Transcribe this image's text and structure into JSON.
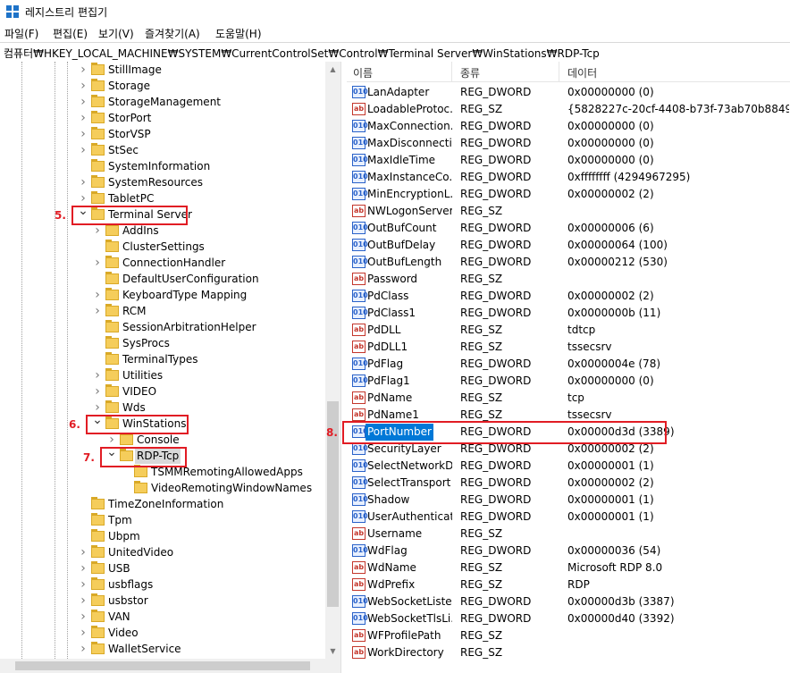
{
  "window": {
    "title": "레지스트리 편집기",
    "icon": "regedit-icon"
  },
  "menu": [
    "파일(F)",
    "편집(E)",
    "보기(V)",
    "즐겨찾기(A)",
    "도움말(H)"
  ],
  "address": "컴퓨터₩HKEY_LOCAL_MACHINE₩SYSTEM₩CurrentControlSet₩Control₩Terminal Server₩WinStations₩RDP-Tcp",
  "tree": {
    "nodes": [
      {
        "label": "StillImage",
        "level": 0,
        "expander": "collapsed"
      },
      {
        "label": "Storage",
        "level": 0,
        "expander": "collapsed"
      },
      {
        "label": "StorageManagement",
        "level": 0,
        "expander": "collapsed"
      },
      {
        "label": "StorPort",
        "level": 0,
        "expander": "collapsed"
      },
      {
        "label": "StorVSP",
        "level": 0,
        "expander": "collapsed"
      },
      {
        "label": "StSec",
        "level": 0,
        "expander": "collapsed"
      },
      {
        "label": "SystemInformation",
        "level": 0,
        "expander": "none"
      },
      {
        "label": "SystemResources",
        "level": 0,
        "expander": "collapsed"
      },
      {
        "label": "TabletPC",
        "level": 0,
        "expander": "collapsed"
      },
      {
        "label": "Terminal Server",
        "level": 0,
        "expander": "expanded"
      },
      {
        "label": "AddIns",
        "level": 1,
        "expander": "collapsed"
      },
      {
        "label": "ClusterSettings",
        "level": 1,
        "expander": "none"
      },
      {
        "label": "ConnectionHandler",
        "level": 1,
        "expander": "collapsed"
      },
      {
        "label": "DefaultUserConfiguration",
        "level": 1,
        "expander": "none"
      },
      {
        "label": "KeyboardType Mapping",
        "level": 1,
        "expander": "collapsed"
      },
      {
        "label": "RCM",
        "level": 1,
        "expander": "collapsed"
      },
      {
        "label": "SessionArbitrationHelper",
        "level": 1,
        "expander": "none"
      },
      {
        "label": "SysProcs",
        "level": 1,
        "expander": "none"
      },
      {
        "label": "TerminalTypes",
        "level": 1,
        "expander": "none"
      },
      {
        "label": "Utilities",
        "level": 1,
        "expander": "collapsed"
      },
      {
        "label": "VIDEO",
        "level": 1,
        "expander": "collapsed"
      },
      {
        "label": "Wds",
        "level": 1,
        "expander": "collapsed"
      },
      {
        "label": "WinStations",
        "level": 1,
        "expander": "expanded"
      },
      {
        "label": "Console",
        "level": 2,
        "expander": "collapsed"
      },
      {
        "label": "RDP-Tcp",
        "level": 2,
        "expander": "expanded",
        "selected": true
      },
      {
        "label": "TSMMRemotingAllowedApps",
        "level": 3,
        "expander": "none"
      },
      {
        "label": "VideoRemotingWindowNames",
        "level": 3,
        "expander": "none"
      },
      {
        "label": "TimeZoneInformation",
        "level": 0,
        "expander": "none"
      },
      {
        "label": "Tpm",
        "level": 0,
        "expander": "none"
      },
      {
        "label": "Ubpm",
        "level": 0,
        "expander": "none"
      },
      {
        "label": "UnitedVideo",
        "level": 0,
        "expander": "collapsed"
      },
      {
        "label": "USB",
        "level": 0,
        "expander": "collapsed"
      },
      {
        "label": "usbflags",
        "level": 0,
        "expander": "collapsed"
      },
      {
        "label": "usbstor",
        "level": 0,
        "expander": "collapsed"
      },
      {
        "label": "VAN",
        "level": 0,
        "expander": "collapsed"
      },
      {
        "label": "Video",
        "level": 0,
        "expander": "collapsed"
      },
      {
        "label": "WalletService",
        "level": 0,
        "expander": "collapsed"
      }
    ]
  },
  "columns": [
    "이름",
    "종류",
    "데이터"
  ],
  "values": [
    {
      "name": "LanAdapter",
      "type": "REG_DWORD",
      "data": "0x00000000 (0)"
    },
    {
      "name": "LoadableProtoc...",
      "type": "REG_SZ",
      "data": "{5828227c-20cf-4408-b73f-73ab70b8849f}"
    },
    {
      "name": "MaxConnection...",
      "type": "REG_DWORD",
      "data": "0x00000000 (0)"
    },
    {
      "name": "MaxDisconnecti...",
      "type": "REG_DWORD",
      "data": "0x00000000 (0)"
    },
    {
      "name": "MaxIdleTime",
      "type": "REG_DWORD",
      "data": "0x00000000 (0)"
    },
    {
      "name": "MaxInstanceCo...",
      "type": "REG_DWORD",
      "data": "0xffffffff (4294967295)"
    },
    {
      "name": "MinEncryptionL...",
      "type": "REG_DWORD",
      "data": "0x00000002 (2)"
    },
    {
      "name": "NWLogonServer",
      "type": "REG_SZ",
      "data": ""
    },
    {
      "name": "OutBufCount",
      "type": "REG_DWORD",
      "data": "0x00000006 (6)"
    },
    {
      "name": "OutBufDelay",
      "type": "REG_DWORD",
      "data": "0x00000064 (100)"
    },
    {
      "name": "OutBufLength",
      "type": "REG_DWORD",
      "data": "0x00000212 (530)"
    },
    {
      "name": "Password",
      "type": "REG_SZ",
      "data": ""
    },
    {
      "name": "PdClass",
      "type": "REG_DWORD",
      "data": "0x00000002 (2)"
    },
    {
      "name": "PdClass1",
      "type": "REG_DWORD",
      "data": "0x0000000b (11)"
    },
    {
      "name": "PdDLL",
      "type": "REG_SZ",
      "data": "tdtcp"
    },
    {
      "name": "PdDLL1",
      "type": "REG_SZ",
      "data": "tssecsrv"
    },
    {
      "name": "PdFlag",
      "type": "REG_DWORD",
      "data": "0x0000004e (78)"
    },
    {
      "name": "PdFlag1",
      "type": "REG_DWORD",
      "data": "0x00000000 (0)"
    },
    {
      "name": "PdName",
      "type": "REG_SZ",
      "data": "tcp"
    },
    {
      "name": "PdName1",
      "type": "REG_SZ",
      "data": "tssecsrv"
    },
    {
      "name": "PortNumber",
      "type": "REG_DWORD",
      "data": "0x00000d3d (3389)",
      "selected": true
    },
    {
      "name": "SecurityLayer",
      "type": "REG_DWORD",
      "data": "0x00000002 (2)"
    },
    {
      "name": "SelectNetworkD...",
      "type": "REG_DWORD",
      "data": "0x00000001 (1)"
    },
    {
      "name": "SelectTransport",
      "type": "REG_DWORD",
      "data": "0x00000002 (2)"
    },
    {
      "name": "Shadow",
      "type": "REG_DWORD",
      "data": "0x00000001 (1)"
    },
    {
      "name": "UserAuthenticat...",
      "type": "REG_DWORD",
      "data": "0x00000001 (1)"
    },
    {
      "name": "Username",
      "type": "REG_SZ",
      "data": ""
    },
    {
      "name": "WdFlag",
      "type": "REG_DWORD",
      "data": "0x00000036 (54)"
    },
    {
      "name": "WdName",
      "type": "REG_SZ",
      "data": "Microsoft RDP 8.0"
    },
    {
      "name": "WdPrefix",
      "type": "REG_SZ",
      "data": "RDP"
    },
    {
      "name": "WebSocketListe...",
      "type": "REG_DWORD",
      "data": "0x00000d3b (3387)"
    },
    {
      "name": "WebSocketTlsLi...",
      "type": "REG_DWORD",
      "data": "0x00000d40 (3392)"
    },
    {
      "name": "WFProfilePath",
      "type": "REG_SZ",
      "data": ""
    },
    {
      "name": "WorkDirectory",
      "type": "REG_SZ",
      "data": ""
    }
  ],
  "icon_text": {
    "dword": "010",
    "sz": "ab"
  },
  "annotations": {
    "step5": "5.",
    "step6": "6.",
    "step7": "7.",
    "step8": "8."
  },
  "colors": {
    "highlight_box": "#e11c24",
    "selection": "#0078d7",
    "folder": "#f5cd5b"
  }
}
